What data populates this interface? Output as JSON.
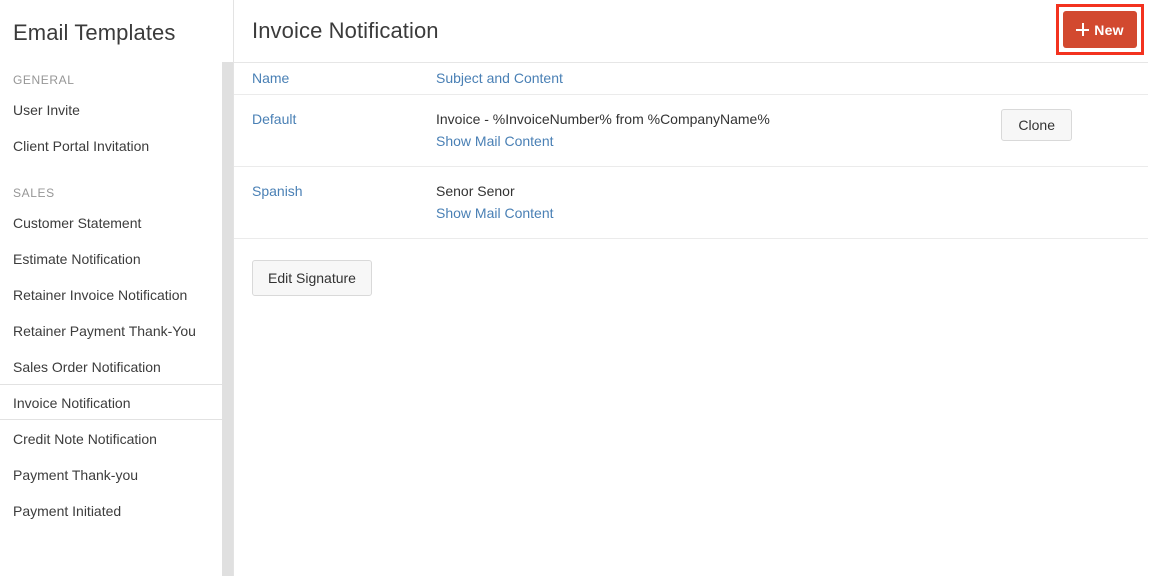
{
  "sidebar": {
    "title": "Email Templates",
    "sections": [
      {
        "label": "GENERAL",
        "items": [
          {
            "label": "User Invite",
            "active": false
          },
          {
            "label": "Client Portal Invitation",
            "active": false
          }
        ]
      },
      {
        "label": "SALES",
        "items": [
          {
            "label": "Customer Statement",
            "active": false
          },
          {
            "label": "Estimate Notification",
            "active": false
          },
          {
            "label": "Retainer Invoice Notification",
            "active": false
          },
          {
            "label": "Retainer Payment Thank-You",
            "active": false
          },
          {
            "label": "Sales Order Notification",
            "active": false
          },
          {
            "label": "Invoice Notification",
            "active": true
          },
          {
            "label": "Credit Note Notification",
            "active": false
          },
          {
            "label": "Payment Thank-you",
            "active": false
          },
          {
            "label": "Payment Initiated",
            "active": false
          }
        ]
      }
    ]
  },
  "content": {
    "title": "Invoice Notification",
    "new_button": {
      "label": "New",
      "icon": "plus-icon",
      "background": "#d2492f",
      "highlight_border": "#f3321f"
    },
    "table": {
      "headers": {
        "name": "Name",
        "subject": "Subject and Content",
        "action": ""
      },
      "rows": [
        {
          "name": "Default",
          "subject": "Invoice - %InvoiceNumber% from %CompanyName%",
          "show_mail_content": "Show Mail Content",
          "action_label": "Clone",
          "has_action": true
        },
        {
          "name": "Spanish",
          "subject": "Senor Senor",
          "show_mail_content": "Show Mail Content",
          "action_label": "",
          "has_action": false
        }
      ]
    },
    "edit_signature_label": "Edit Signature"
  },
  "colors": {
    "link": "#4a80b5",
    "accent": "#d2492f",
    "annotation": "#f3321f",
    "border": "#ebebeb"
  }
}
